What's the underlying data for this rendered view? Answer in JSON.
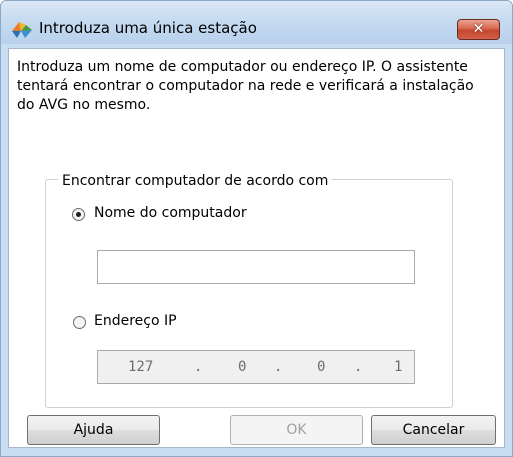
{
  "window": {
    "title": "Introduza uma única estação",
    "close_glyph": "✕",
    "app_icon": "avg-logo-icon"
  },
  "intro_text": "Introduza um nome de computador ou endereço IP. O assistente tentará encontrar o computador na rede e verificará a instalação do AVG no mesmo.",
  "group": {
    "label": "Encontrar computador de acordo com",
    "options": [
      {
        "label": "Nome do computador",
        "selected": true
      },
      {
        "label": "Endereço IP",
        "selected": false
      }
    ],
    "computer_name": {
      "value": "",
      "placeholder": ""
    },
    "ip_address": {
      "octets": [
        "127",
        "0",
        "0",
        "1"
      ],
      "separator": "."
    }
  },
  "buttons": {
    "help": "Ajuda",
    "ok": "OK",
    "cancel": "Cancelar",
    "ok_enabled": false
  },
  "colors": {
    "frame": "#c9ddf2",
    "close_button": "#c6452d",
    "accent_orange": "#e97e2a",
    "accent_green": "#4b9a3a",
    "accent_blue": "#2a6fb3"
  }
}
